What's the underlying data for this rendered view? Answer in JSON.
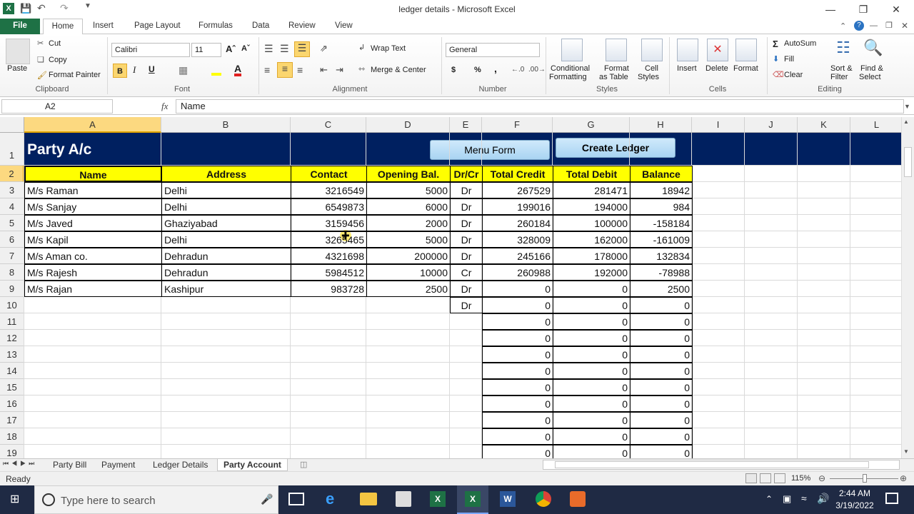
{
  "window": {
    "title": "ledger details - Microsoft Excel"
  },
  "quick_access": {
    "save_icon": "save-icon",
    "undo_icon": "undo-icon",
    "redo_icon": "redo-icon"
  },
  "tabs": [
    "File",
    "Home",
    "Insert",
    "Page Layout",
    "Formulas",
    "Data",
    "Review",
    "View"
  ],
  "ribbon": {
    "clipboard": {
      "paste": "Paste",
      "cut": "Cut",
      "copy": "Copy",
      "format_painter": "Format Painter",
      "label": "Clipboard"
    },
    "font": {
      "name": "Calibri",
      "size": "11",
      "label": "Font",
      "bold": "B",
      "italic": "I",
      "underline": "U"
    },
    "alignment": {
      "wrap_text": "Wrap Text",
      "merge_center": "Merge & Center",
      "label": "Alignment"
    },
    "number": {
      "format": "General",
      "currency": "$",
      "percent": "%",
      "comma": ",",
      "label": "Number"
    },
    "styles": {
      "conditional": "Conditional",
      "formatting": "Formatting",
      "format_as": "Format",
      "as_table": "as Table",
      "cell": "Cell",
      "styles_word": "Styles",
      "label": "Styles"
    },
    "cells": {
      "insert": "Insert",
      "delete": "Delete",
      "format": "Format",
      "label": "Cells"
    },
    "editing": {
      "autosum": "AutoSum",
      "fill": "Fill",
      "clear": "Clear",
      "sort": "Sort &",
      "filter": "Filter",
      "find": "Find &",
      "select": "Select",
      "label": "Editing"
    }
  },
  "formula_bar": {
    "name_box": "A2",
    "fx": "fx",
    "content": "Name"
  },
  "columns": [
    "A",
    "B",
    "C",
    "D",
    "E",
    "F",
    "G",
    "H",
    "I",
    "J",
    "K",
    "L"
  ],
  "rows": [
    "1",
    "2",
    "3",
    "4",
    "5",
    "6",
    "7",
    "8",
    "9",
    "10",
    "11",
    "12",
    "13",
    "14",
    "15",
    "16",
    "17",
    "18",
    "19"
  ],
  "sheet": {
    "title": "Party A/c",
    "menu_button": "Menu Form",
    "create_button": "Create Ledger",
    "headers": [
      "Name",
      "Address",
      "Contact",
      "Opening Bal.",
      "Dr/Cr",
      "Total Credit",
      "Total Debit",
      "Balance"
    ],
    "data": [
      [
        "M/s Raman",
        "Delhi",
        "3216549",
        "5000",
        "Dr",
        "267529",
        "281471",
        "18942"
      ],
      [
        "M/s Sanjay",
        "Delhi",
        "6549873",
        "6000",
        "Dr",
        "199016",
        "194000",
        "984"
      ],
      [
        "M/s Javed",
        "Ghaziyabad",
        "3159456",
        "2000",
        "Dr",
        "260184",
        "100000",
        "-158184"
      ],
      [
        "M/s Kapil",
        "Delhi",
        "3265465",
        "5000",
        "Dr",
        "328009",
        "162000",
        "-161009"
      ],
      [
        "M/s Aman co.",
        "Dehradun",
        "4321698",
        "200000",
        "Dr",
        "245166",
        "178000",
        "132834"
      ],
      [
        "M/s Rajesh",
        "Dehradun",
        "5984512",
        "10000",
        "Cr",
        "260988",
        "192000",
        "-78988"
      ],
      [
        "M/s Rajan",
        "Kashipur",
        "983728",
        "2500",
        "Dr",
        "0",
        "0",
        "2500"
      ],
      [
        "",
        "",
        "",
        "",
        "Dr",
        "0",
        "0",
        "0"
      ],
      [
        "",
        "",
        "",
        "",
        "",
        "0",
        "0",
        "0"
      ],
      [
        "",
        "",
        "",
        "",
        "",
        "0",
        "0",
        "0"
      ],
      [
        "",
        "",
        "",
        "",
        "",
        "0",
        "0",
        "0"
      ],
      [
        "",
        "",
        "",
        "",
        "",
        "0",
        "0",
        "0"
      ],
      [
        "",
        "",
        "",
        "",
        "",
        "0",
        "0",
        "0"
      ],
      [
        "",
        "",
        "",
        "",
        "",
        "0",
        "0",
        "0"
      ],
      [
        "",
        "",
        "",
        "",
        "",
        "0",
        "0",
        "0"
      ],
      [
        "",
        "",
        "",
        "",
        "",
        "0",
        "0",
        "0"
      ],
      [
        "",
        "",
        "",
        "",
        "",
        "0",
        "0",
        "0"
      ]
    ]
  },
  "sheet_tabs": [
    "Party Bill",
    "Payment",
    "Ledger Details",
    "Party Account"
  ],
  "active_sheet": "Party Account",
  "status": {
    "ready": "Ready",
    "zoom": "115%"
  },
  "taskbar": {
    "search_placeholder": "Type here to search",
    "time": "2:44 AM",
    "date": "3/19/2022"
  },
  "colors": {
    "header_band": "#002060",
    "header_yellow": "#ffff00",
    "excel_green": "#1e7145"
  }
}
